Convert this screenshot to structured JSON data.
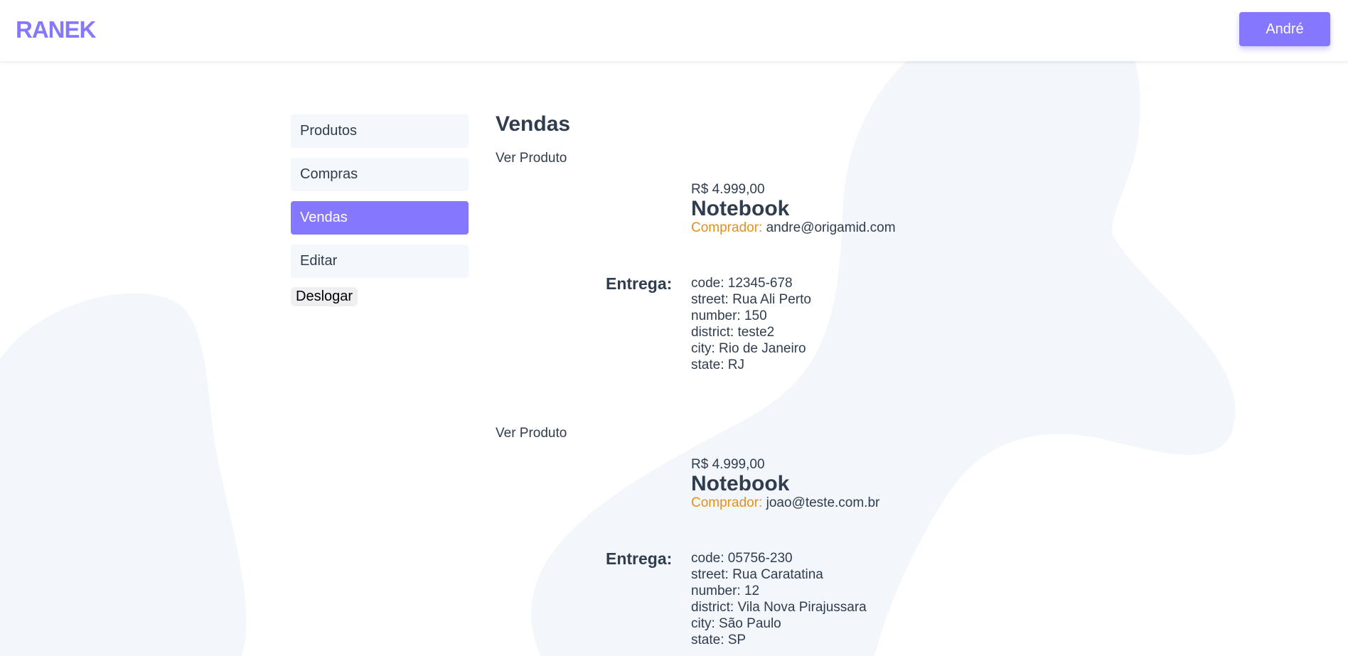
{
  "header": {
    "logo_text": "RANEK",
    "user_button_label": "André"
  },
  "colors": {
    "accent": "#8577fe",
    "buyer_label": "#e78f1e",
    "text": "#2f3d4e",
    "nav_bg": "#f4f7fc",
    "blob": "#f3f6fb"
  },
  "sidebar": {
    "items": [
      {
        "label": "Produtos",
        "active": false
      },
      {
        "label": "Compras",
        "active": false
      },
      {
        "label": "Vendas",
        "active": true
      },
      {
        "label": "Editar",
        "active": false
      }
    ],
    "logout_label": "Deslogar"
  },
  "main": {
    "title": "Vendas",
    "sales": [
      {
        "link_label": "Ver Produto",
        "price": "R$ 4.999,00",
        "product_name": "Notebook",
        "buyer_label": "Comprador:",
        "buyer_email": "andre@origamid.com",
        "delivery_label": "Entrega:",
        "address": [
          "code: 12345-678",
          "street: Rua Ali Perto",
          "number: 150",
          "district: teste2",
          "city: Rio de Janeiro",
          "state: RJ"
        ]
      },
      {
        "link_label": "Ver Produto",
        "price": "R$ 4.999,00",
        "product_name": "Notebook",
        "buyer_label": "Comprador:",
        "buyer_email": "joao@teste.com.br",
        "delivery_label": "Entrega:",
        "address": [
          "code: 05756-230",
          "street: Rua Caratatina",
          "number: 12",
          "district: Vila Nova Pirajussara",
          "city: São Paulo",
          "state: SP"
        ]
      }
    ]
  }
}
